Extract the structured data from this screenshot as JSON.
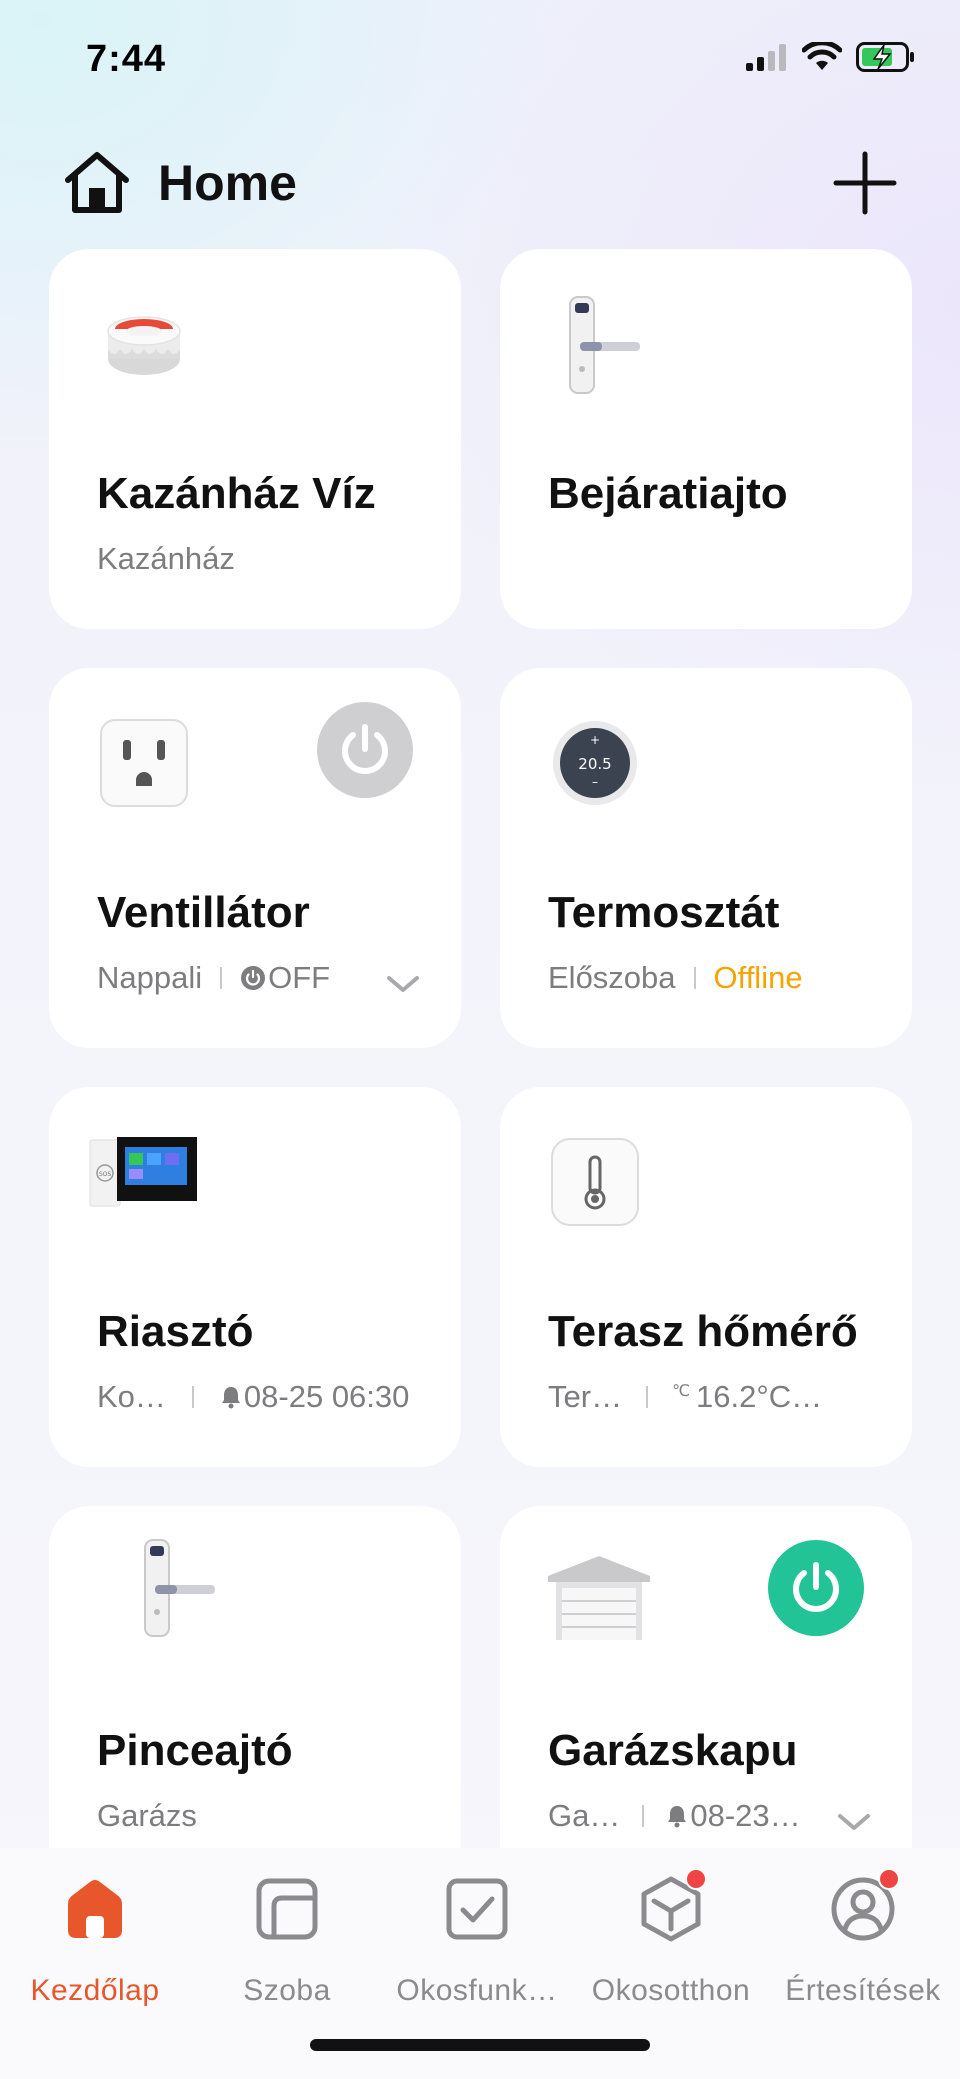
{
  "status_bar": {
    "time": "7:44"
  },
  "header": {
    "title": "Home"
  },
  "devices": [
    {
      "name": "Kazánház Víz",
      "room": "Kazánház",
      "icon": "water-sensor-icon"
    },
    {
      "name": "Bejáratiajto",
      "room": "",
      "icon": "door-lock-icon"
    },
    {
      "name": "Ventillátor",
      "room": "Nappali",
      "state": "OFF",
      "icon": "smart-plug-icon",
      "power_on": false
    },
    {
      "name": "Termosztát",
      "room": "Előszoba",
      "state": "Offline",
      "icon": "thermostat-icon",
      "thermostat_value": "20.5"
    },
    {
      "name": "Riasztó",
      "room": "Ko…",
      "state": "08-25 06:30",
      "icon": "alarm-panel-icon",
      "panel_label": "SOS"
    },
    {
      "name": "Terasz hőmérő",
      "room": "Ter…",
      "state": "16.2°C…",
      "unit_glyph": "℃",
      "icon": "thermometer-icon"
    },
    {
      "name": "Pinceajtó",
      "room": "Garázs",
      "icon": "door-lock-icon"
    },
    {
      "name": "Garázskapu",
      "room": "Ga…",
      "state": "08-23…",
      "icon": "garage-door-icon",
      "power_on": true
    }
  ],
  "tabs": [
    {
      "label": "Kezdőlap",
      "icon": "home-tab-icon",
      "active": true
    },
    {
      "label": "Szoba",
      "icon": "room-icon"
    },
    {
      "label": "Okosfunk…",
      "icon": "smart-scene-icon"
    },
    {
      "label": "Okosotthon",
      "icon": "cube-icon",
      "badge": true
    },
    {
      "label": "Értesítések",
      "icon": "profile-icon",
      "badge": true
    }
  ],
  "colors": {
    "accent": "#e8562b",
    "power_on": "#22c497",
    "power_off": "#cfcfd2",
    "offline": "#f5a400",
    "badge": "#f04444"
  }
}
